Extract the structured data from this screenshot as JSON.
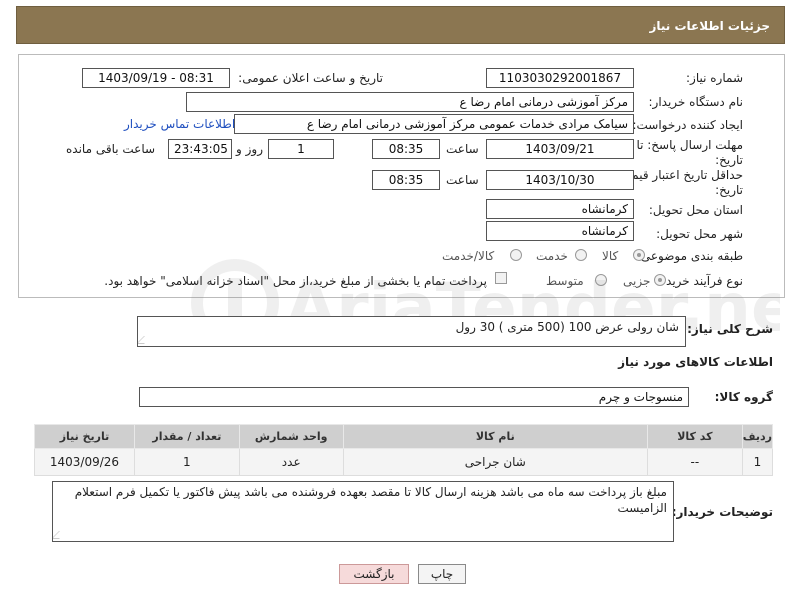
{
  "header": {
    "title": "جزئیات اطلاعات نیاز"
  },
  "form": {
    "need_number_label": "شماره نیاز:",
    "need_number": "1103030292001867",
    "announce_label": "تاریخ و ساعت اعلان عمومی:",
    "announce_value": "1403/09/19 - 08:31",
    "buyer_label": "نام دستگاه خریدار:",
    "buyer_value": "مرکز آموزشی  درمانی امام رضا  ع",
    "creator_label": "ایجاد کننده درخواست:",
    "creator_value": "سیامک مرادی خدمات عمومی مرکز آموزشی  درمانی امام رضا  ع",
    "contact_link": "اطلاعات تماس خریدار",
    "deadline_label_1": "مهلت ارسال پاسخ: تا",
    "deadline_label_2": "تاریخ:",
    "deadline_date": "1403/09/21",
    "time_label": "ساعت",
    "deadline_time": "08:35",
    "days_value": "1",
    "days_label": "روز و",
    "remaining_time": "23:43:05",
    "remaining_label": "ساعت باقی مانده",
    "validity_label_1": "حداقل تاریخ اعتبار قیمت: تا",
    "validity_label_2": "تاریخ:",
    "validity_date": "1403/10/30",
    "validity_time": "08:35",
    "province_label": "استان محل تحویل:",
    "province_value": "کرمانشاه",
    "city_label": "شهر محل تحویل:",
    "city_value": "کرمانشاه",
    "category_label": "طبقه بندی موضوعی:",
    "category_options": [
      "کالا",
      "خدمت",
      "کالا/خدمت"
    ],
    "process_label": "نوع فرآیند خرید :",
    "process_options": [
      "جزیی",
      "متوسط"
    ],
    "payment_note": "پرداخت تمام یا بخشی از مبلغ خرید،از محل \"اسناد خزانه اسلامی\" خواهد بود."
  },
  "summary": {
    "label": "شرح کلی نیاز:",
    "value": "شان رولی  عرض 100 (500 متری )  30 رول"
  },
  "goods_section_title": "اطلاعات کالاهای مورد نیاز",
  "goods_group": {
    "label": "گروه کالا:",
    "value": "منسوجات و چرم"
  },
  "table": {
    "headers": [
      "ردیف",
      "کد کالا",
      "نام کالا",
      "واحد شمارش",
      "تعداد / مقدار",
      "تاریخ نیاز"
    ],
    "rows": [
      [
        "1",
        "--",
        "شان جراحی",
        "عدد",
        "1",
        "1403/09/26"
      ]
    ]
  },
  "buyer_notes": {
    "label": "توضیحات خریدار:",
    "value": "مبلغ باز پرداخت سه ماه می باشد هزینه ارسال کالا تا مقصد بعهده فروشنده می باشد پیش فاکتور یا تکمیل فرم استعلام الزامیست"
  },
  "buttons": {
    "print": "چاپ",
    "back": "بازگشت"
  },
  "watermark": {
    "brand": "AriaTender.neT"
  },
  "colors": {
    "titlebar": "#8b7651",
    "link": "#1f4fbf",
    "table_header": "#cfcfcf"
  }
}
